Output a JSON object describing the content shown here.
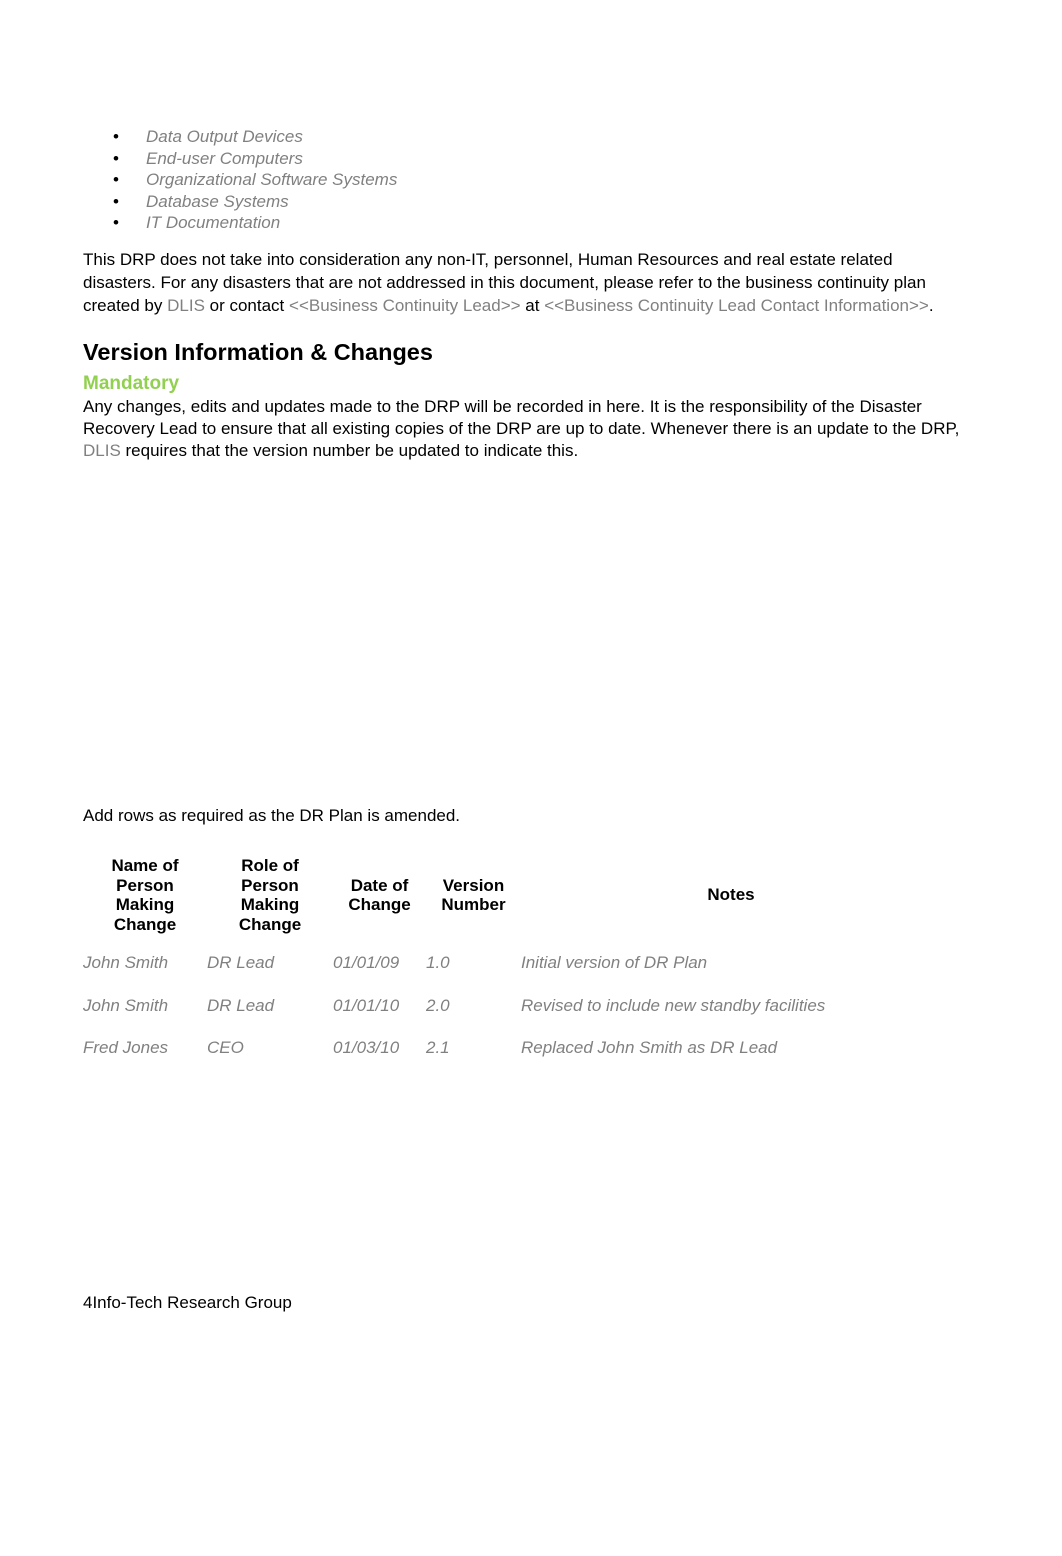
{
  "bullets": [
    "Data Output Devices",
    "End-user Computers",
    "Organizational Software Systems",
    "Database Systems",
    "IT Documentation"
  ],
  "bullet_glyph": "•",
  "scope_paragraph": {
    "text_1": "This DRP does not take into consideration any non-IT, personnel, Human Resources and real estate related disasters. For any disasters that are not addressed in this document, please refer to the business continuity plan created by ",
    "org": "DLIS",
    "text_2": " or contact ",
    "bc_lead": "<<Business Continuity Lead>>",
    "text_3": " at ",
    "bc_contact": "<<Business Continuity Lead Contact Information>>",
    "text_4": "."
  },
  "section": {
    "title": "Version Information & Changes",
    "subtitle": "Mandatory",
    "subtitle_color": "#92D050",
    "body_1": "Any changes, edits and updates made to the DRP will be recorded in here. It is the responsibility of the Disaster Recovery Lead to ensure that all existing copies of the DRP are up to date. Whenever there is an update to the DRP, ",
    "org": "DLIS",
    "body_2": " requires that the version number be updated to indicate this."
  },
  "table_intro": "Add rows as required as the DR Plan is amended.",
  "version_table": {
    "headers": {
      "name": [
        "Name of",
        "Person",
        "Making",
        "Change"
      ],
      "role": [
        "Role of",
        "Person",
        "Making",
        "Change"
      ],
      "date": [
        "Date of",
        "Change"
      ],
      "version": [
        "Version",
        "Number"
      ],
      "notes": [
        "Notes"
      ]
    },
    "rows": [
      {
        "name": "John Smith",
        "role": "DR Lead",
        "date": "01/01/09",
        "version": "1.0",
        "notes": "Initial version of DR Plan"
      },
      {
        "name": "John Smith",
        "role": "DR Lead",
        "date": "01/01/10",
        "version": "2.0",
        "notes": "Revised to include new standby facilities"
      },
      {
        "name": "Fred Jones",
        "role": "CEO",
        "date": "01/03/10",
        "version": "2.1",
        "notes": "Replaced John Smith as DR Lead"
      }
    ]
  },
  "footer": "4Info-Tech Research Group"
}
